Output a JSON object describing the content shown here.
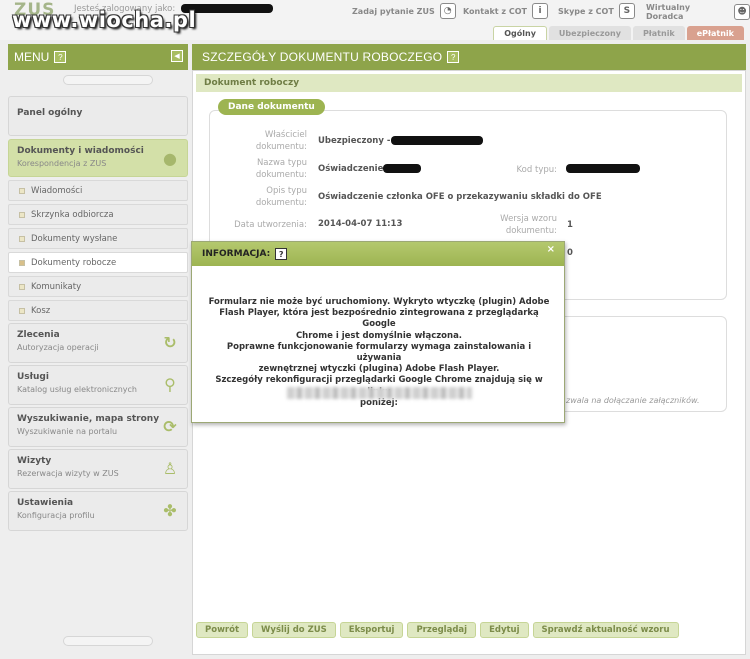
{
  "header": {
    "logo": "ZUS",
    "watermark": "www.wiocha.pl",
    "logged_in_label": "Jesteś zalogowany jako:",
    "links": [
      {
        "label": "Zadaj pytanie ZUS",
        "icon": "chat-bubble-icon"
      },
      {
        "label": "Kontakt z COT",
        "icon": "info-icon"
      },
      {
        "label": "Skype z COT",
        "icon": "skype-icon"
      },
      {
        "label": "Wirtualny Doradca",
        "icon": "person-icon"
      }
    ],
    "tabs": [
      "Ogólny",
      "Ubezpieczony",
      "Płatnik",
      "ePłatnik"
    ]
  },
  "sidebar": {
    "title": "MENU",
    "help": "?",
    "panel": "Panel ogólny",
    "docs": {
      "title": "Dokumenty i wiadomości",
      "subtitle": "Korespondencja z ZUS"
    },
    "subitems": [
      "Wiadomości",
      "Skrzynka odbiorcza",
      "Dokumenty wysłane",
      "Dokumenty robocze",
      "Komunikaty",
      "Kosz"
    ],
    "sections": [
      {
        "title": "Zlecenia",
        "subtitle": "Autoryzacja operacji",
        "icon": "refresh-icon"
      },
      {
        "title": "Usługi",
        "subtitle": "Katalog usług elektronicznych",
        "icon": "services-icon"
      },
      {
        "title": "Wyszukiwanie, mapa strony",
        "subtitle": "Wyszukiwanie na portalu",
        "icon": "search-cycle-icon"
      },
      {
        "title": "Wizyty",
        "subtitle": "Rezerwacja wizyty w ZUS",
        "icon": "walking-icon"
      },
      {
        "title": "Ustawienia",
        "subtitle": "Konfiguracja profilu",
        "icon": "puzzle-icon"
      }
    ]
  },
  "main": {
    "title": "SZCZEGÓŁY DOKUMENTU ROBOCZEGO",
    "doc_bar": "Dokument roboczy",
    "section": "Dane dokumentu",
    "fields": {
      "owner_label": "Właściciel dokumentu:",
      "owner_value": "Ubezpieczony -",
      "type_label": "Nazwa typu dokumentu:",
      "type_value": "Oświadczenie",
      "code_label": "Kod typu:",
      "desc_label": "Opis typu dokumentu:",
      "desc_value": "Oświadczenie członka OFE o przekazywaniu składki do OFE",
      "date_label": "Data utworzenia:",
      "date_value": "2014-04-07 11:13",
      "version_label": "Wersja wzoru dokumentu:",
      "version_value": "1",
      "hidden_value": "0"
    },
    "attachment_hint": "zwala na dołączanie załączników.",
    "buttons": [
      "Powrót",
      "Wyślij do ZUS",
      "Eksportuj",
      "Przeglądaj",
      "Edytuj",
      "Sprawdź aktualność wzoru"
    ]
  },
  "modal": {
    "title": "INFORMACJA:",
    "help": "?",
    "close": "×",
    "lines": [
      "Formularz nie może być uruchomiony. Wykryto wtyczkę (plugin) Adobe",
      "Flash Player, która jest bezpośrednio zintegrowana z przeglądarką Google",
      "Chrome i jest domyślnie włączona.",
      "Poprawne funkcjonowanie formularzy wymaga zainstalowania i używania",
      "zewnętrznej wtyczki (plugina) Adobe Flash Player.",
      "Szczegóły rekonfiguracji przeglądarki Google Chrome znajdują się w linku",
      "poniżej:"
    ]
  }
}
